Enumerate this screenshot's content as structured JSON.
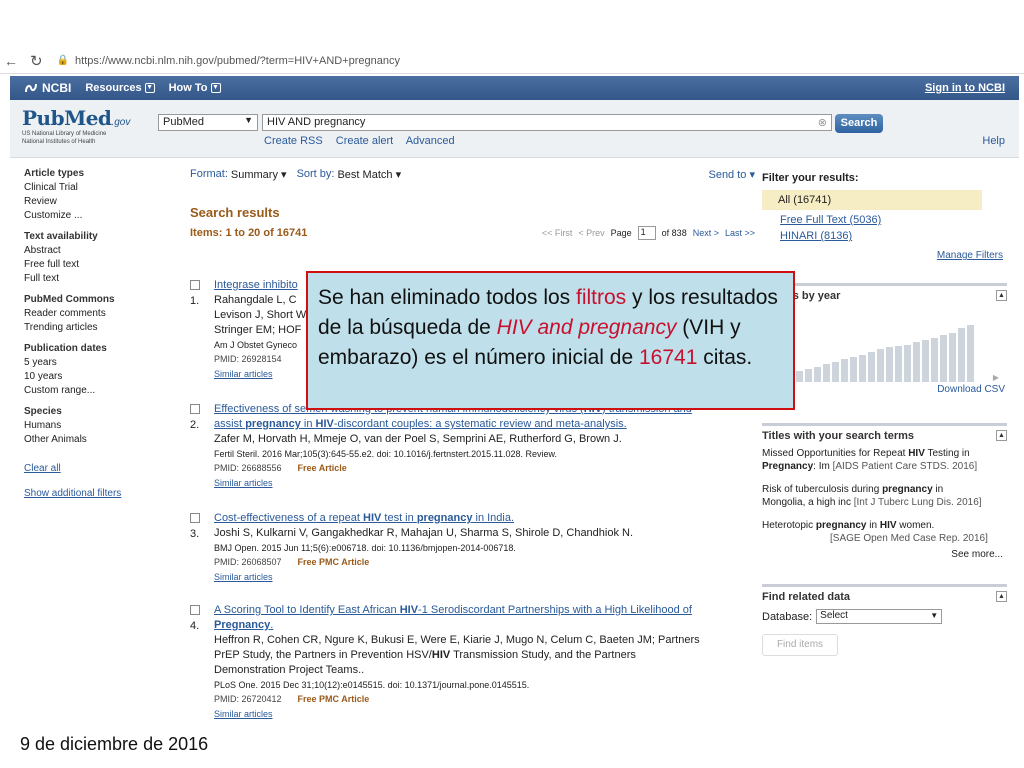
{
  "browser": {
    "url": "https://www.ncbi.nlm.nih.gov/pubmed/?term=HIV+AND+pregnancy"
  },
  "ncbi_bar": {
    "logo": "NCBI",
    "resources": "Resources",
    "howto": "How To",
    "signin": "Sign in to NCBI"
  },
  "logo": {
    "word": "PubMed",
    "gov": ".gov",
    "line1": "US National Library of Medicine",
    "line2": "National Institutes of Health"
  },
  "search": {
    "db": "PubMed",
    "query": "HIV AND pregnancy",
    "button": "Search",
    "create_rss": "Create RSS",
    "create_alert": "Create alert",
    "advanced": "Advanced",
    "help": "Help"
  },
  "sidebar": {
    "article_types": {
      "title": "Article types",
      "items": [
        "Clinical Trial",
        "Review",
        "Customize ..."
      ]
    },
    "text_availability": {
      "title": "Text availability",
      "items": [
        "Abstract",
        "Free full text",
        "Full text"
      ]
    },
    "commons": {
      "title": "PubMed Commons",
      "items": [
        "Reader comments",
        "Trending articles"
      ]
    },
    "pub_dates": {
      "title": "Publication dates",
      "items": [
        "5 years",
        "10 years",
        "Custom range..."
      ]
    },
    "species": {
      "title": "Species",
      "items": [
        "Humans",
        "Other Animals"
      ]
    },
    "clear_all": "Clear all",
    "show_filters": "Show additional filters"
  },
  "main": {
    "format_k": "Format:",
    "format_v": "Summary",
    "sort_k": "Sort by:",
    "sort_v": "Best Match",
    "send_to": "Send to",
    "results_title": "Search results",
    "items": "Items: 1 to 20 of 16741",
    "pager": {
      "first": "<< First",
      "prev": "< Prev",
      "page": "Page",
      "page_num": "1",
      "of": "of 838",
      "next": "Next >",
      "last": "Last >>"
    }
  },
  "results": [
    {
      "num": "1.",
      "title": "Integrase inhibito",
      "authors1": "Rahangdale L, C",
      "authors2": "Levison J, Short W",
      "authors3": "Stringer EM; HOF",
      "cite": "Am J Obstet Gyneco",
      "pmid": "PMID: 26928154",
      "free": "",
      "similar": "Similar articles"
    },
    {
      "num": "2.",
      "title_a": "Effectiveness of semen washing to prevent human immunodeficiency virus (",
      "title_b": "HIV",
      "title_c": ") transmission and",
      "title2_a": "assist ",
      "title2_b": "pregnancy",
      "title2_c": " in ",
      "title2_d": "HIV",
      "title2_e": "-discordant couples: a systematic review and meta-analysis.",
      "authors": "Zafer M, Horvath H, Mmeje O, van der Poel S, Semprini AE, Rutherford G, Brown J.",
      "cite": "Fertil Steril. 2016 Mar;105(3):645-55.e2. doi: 10.1016/j.fertnstert.2015.11.028. Review.",
      "pmid": "PMID: 26688556",
      "free": "Free Article",
      "similar": "Similar articles"
    },
    {
      "num": "3.",
      "title_a": "Cost-effectiveness of a repeat ",
      "title_b": "HIV",
      "title_c": " test in ",
      "title_d": "pregnancy",
      "title_e": " in India.",
      "authors": "Joshi S, Kulkarni V, Gangakhedkar R, Mahajan U, Sharma S, Shirole D, Chandhiok N.",
      "cite": "BMJ Open. 2015 Jun 11;5(6):e006718. doi: 10.1136/bmjopen-2014-006718.",
      "pmid": "PMID: 26068507",
      "free": "Free PMC Article",
      "similar": "Similar articles"
    },
    {
      "num": "4.",
      "title_a": "A Scoring Tool to Identify East African ",
      "title_b": "HIV",
      "title_c": "-1 Serodiscordant Partnerships with a High Likelihood of",
      "title2": "Pregnancy",
      "title2_end": ".",
      "authors1": "Heffron R, Cohen CR, Ngure K, Bukusi E, Were E, Kiarie J, Mugo N, Celum C, Baeten JM; Partners",
      "authors2_a": "PrEP Study, the Partners in Prevention HSV/",
      "authors2_b": "HIV",
      "authors2_c": " Transmission Study, and the Partners",
      "authors3": "Demonstration Project Teams..",
      "cite": "PLoS One. 2015 Dec 31;10(12):e0145515. doi: 10.1371/journal.pone.0145515.",
      "pmid": "PMID: 26720412",
      "free": "Free PMC Article",
      "similar": "Similar articles"
    }
  ],
  "right": {
    "filter_title": "Filter your results:",
    "all": "All (16741)",
    "free_full": "Free Full Text (5036)",
    "hinari": "HINARI (8136)",
    "manage": "Manage Filters",
    "by_year": "lts by year",
    "download": "Download CSV",
    "titles_head": "Titles with your search terms",
    "t1_a": "Missed Opportunities for Repeat ",
    "t1_b": "HIV",
    "t1_c": " Testing in",
    "t1_d": "Pregnancy",
    "t1_e": ": Im",
    "t1_src": "[AIDS Patient Care STDS. 2016]",
    "t2_a": "Risk of tuberculosis during ",
    "t2_b": "pregnancy",
    "t2_c": " in",
    "t2_d": "Mongolia, a high inc",
    "t2_src": "[Int J Tuberc Lung Dis. 2016]",
    "t3_a": "Heterotopic ",
    "t3_b": "pregnancy",
    "t3_c": " in ",
    "t3_d": "HIV",
    "t3_e": " women.",
    "t3_src": "[SAGE Open Med Case Rep. 2016]",
    "see_more": "See more...",
    "related_head": "Find related data",
    "db_label": "Database:",
    "db_select": "Select",
    "find_items": "Find items",
    "year_bars": [
      0.18,
      0.22,
      0.25,
      0.3,
      0.34,
      0.38,
      0.42,
      0.45,
      0.5,
      0.55,
      0.58,
      0.6,
      0.62,
      0.66,
      0.7,
      0.74,
      0.78,
      0.82,
      0.9,
      0.95
    ]
  },
  "overlay": {
    "p1": "Se han eliminado todos los ",
    "p2": "filtros",
    "p3": " y los resultados de la búsqueda de ",
    "p4": "HIV and pregnancy",
    "p5": " (VIH y embarazo) es el número inicial de ",
    "p6": "16741",
    "p7": " citas."
  },
  "footer": {
    "date": "9 de diciembre de 2016"
  }
}
